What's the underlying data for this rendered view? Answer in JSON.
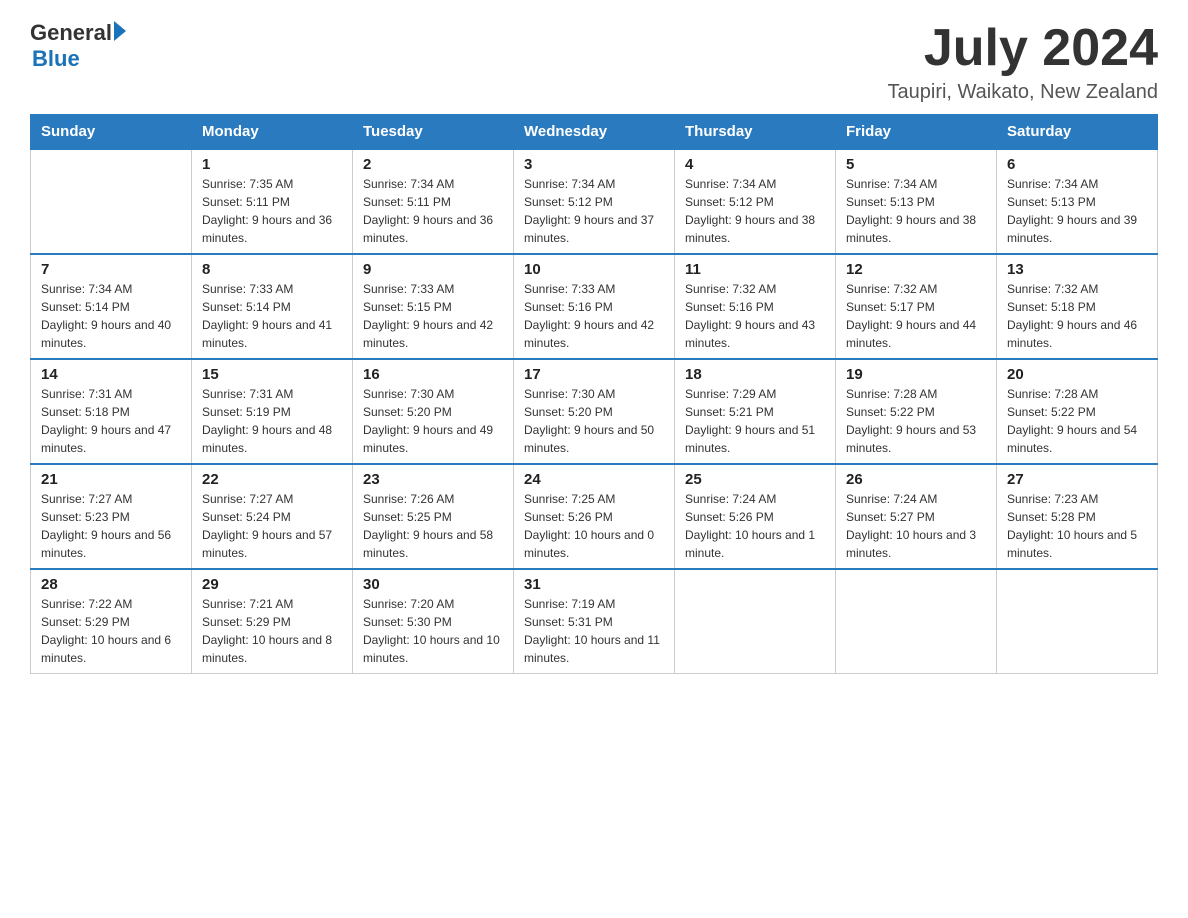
{
  "header": {
    "logo_general": "General",
    "logo_blue": "Blue",
    "month_title": "July 2024",
    "location": "Taupiri, Waikato, New Zealand"
  },
  "weekdays": [
    "Sunday",
    "Monday",
    "Tuesday",
    "Wednesday",
    "Thursday",
    "Friday",
    "Saturday"
  ],
  "weeks": [
    [
      {
        "day": "",
        "sunrise": "",
        "sunset": "",
        "daylight": ""
      },
      {
        "day": "1",
        "sunrise": "Sunrise: 7:35 AM",
        "sunset": "Sunset: 5:11 PM",
        "daylight": "Daylight: 9 hours and 36 minutes."
      },
      {
        "day": "2",
        "sunrise": "Sunrise: 7:34 AM",
        "sunset": "Sunset: 5:11 PM",
        "daylight": "Daylight: 9 hours and 36 minutes."
      },
      {
        "day": "3",
        "sunrise": "Sunrise: 7:34 AM",
        "sunset": "Sunset: 5:12 PM",
        "daylight": "Daylight: 9 hours and 37 minutes."
      },
      {
        "day": "4",
        "sunrise": "Sunrise: 7:34 AM",
        "sunset": "Sunset: 5:12 PM",
        "daylight": "Daylight: 9 hours and 38 minutes."
      },
      {
        "day": "5",
        "sunrise": "Sunrise: 7:34 AM",
        "sunset": "Sunset: 5:13 PM",
        "daylight": "Daylight: 9 hours and 38 minutes."
      },
      {
        "day": "6",
        "sunrise": "Sunrise: 7:34 AM",
        "sunset": "Sunset: 5:13 PM",
        "daylight": "Daylight: 9 hours and 39 minutes."
      }
    ],
    [
      {
        "day": "7",
        "sunrise": "Sunrise: 7:34 AM",
        "sunset": "Sunset: 5:14 PM",
        "daylight": "Daylight: 9 hours and 40 minutes."
      },
      {
        "day": "8",
        "sunrise": "Sunrise: 7:33 AM",
        "sunset": "Sunset: 5:14 PM",
        "daylight": "Daylight: 9 hours and 41 minutes."
      },
      {
        "day": "9",
        "sunrise": "Sunrise: 7:33 AM",
        "sunset": "Sunset: 5:15 PM",
        "daylight": "Daylight: 9 hours and 42 minutes."
      },
      {
        "day": "10",
        "sunrise": "Sunrise: 7:33 AM",
        "sunset": "Sunset: 5:16 PM",
        "daylight": "Daylight: 9 hours and 42 minutes."
      },
      {
        "day": "11",
        "sunrise": "Sunrise: 7:32 AM",
        "sunset": "Sunset: 5:16 PM",
        "daylight": "Daylight: 9 hours and 43 minutes."
      },
      {
        "day": "12",
        "sunrise": "Sunrise: 7:32 AM",
        "sunset": "Sunset: 5:17 PM",
        "daylight": "Daylight: 9 hours and 44 minutes."
      },
      {
        "day": "13",
        "sunrise": "Sunrise: 7:32 AM",
        "sunset": "Sunset: 5:18 PM",
        "daylight": "Daylight: 9 hours and 46 minutes."
      }
    ],
    [
      {
        "day": "14",
        "sunrise": "Sunrise: 7:31 AM",
        "sunset": "Sunset: 5:18 PM",
        "daylight": "Daylight: 9 hours and 47 minutes."
      },
      {
        "day": "15",
        "sunrise": "Sunrise: 7:31 AM",
        "sunset": "Sunset: 5:19 PM",
        "daylight": "Daylight: 9 hours and 48 minutes."
      },
      {
        "day": "16",
        "sunrise": "Sunrise: 7:30 AM",
        "sunset": "Sunset: 5:20 PM",
        "daylight": "Daylight: 9 hours and 49 minutes."
      },
      {
        "day": "17",
        "sunrise": "Sunrise: 7:30 AM",
        "sunset": "Sunset: 5:20 PM",
        "daylight": "Daylight: 9 hours and 50 minutes."
      },
      {
        "day": "18",
        "sunrise": "Sunrise: 7:29 AM",
        "sunset": "Sunset: 5:21 PM",
        "daylight": "Daylight: 9 hours and 51 minutes."
      },
      {
        "day": "19",
        "sunrise": "Sunrise: 7:28 AM",
        "sunset": "Sunset: 5:22 PM",
        "daylight": "Daylight: 9 hours and 53 minutes."
      },
      {
        "day": "20",
        "sunrise": "Sunrise: 7:28 AM",
        "sunset": "Sunset: 5:22 PM",
        "daylight": "Daylight: 9 hours and 54 minutes."
      }
    ],
    [
      {
        "day": "21",
        "sunrise": "Sunrise: 7:27 AM",
        "sunset": "Sunset: 5:23 PM",
        "daylight": "Daylight: 9 hours and 56 minutes."
      },
      {
        "day": "22",
        "sunrise": "Sunrise: 7:27 AM",
        "sunset": "Sunset: 5:24 PM",
        "daylight": "Daylight: 9 hours and 57 minutes."
      },
      {
        "day": "23",
        "sunrise": "Sunrise: 7:26 AM",
        "sunset": "Sunset: 5:25 PM",
        "daylight": "Daylight: 9 hours and 58 minutes."
      },
      {
        "day": "24",
        "sunrise": "Sunrise: 7:25 AM",
        "sunset": "Sunset: 5:26 PM",
        "daylight": "Daylight: 10 hours and 0 minutes."
      },
      {
        "day": "25",
        "sunrise": "Sunrise: 7:24 AM",
        "sunset": "Sunset: 5:26 PM",
        "daylight": "Daylight: 10 hours and 1 minute."
      },
      {
        "day": "26",
        "sunrise": "Sunrise: 7:24 AM",
        "sunset": "Sunset: 5:27 PM",
        "daylight": "Daylight: 10 hours and 3 minutes."
      },
      {
        "day": "27",
        "sunrise": "Sunrise: 7:23 AM",
        "sunset": "Sunset: 5:28 PM",
        "daylight": "Daylight: 10 hours and 5 minutes."
      }
    ],
    [
      {
        "day": "28",
        "sunrise": "Sunrise: 7:22 AM",
        "sunset": "Sunset: 5:29 PM",
        "daylight": "Daylight: 10 hours and 6 minutes."
      },
      {
        "day": "29",
        "sunrise": "Sunrise: 7:21 AM",
        "sunset": "Sunset: 5:29 PM",
        "daylight": "Daylight: 10 hours and 8 minutes."
      },
      {
        "day": "30",
        "sunrise": "Sunrise: 7:20 AM",
        "sunset": "Sunset: 5:30 PM",
        "daylight": "Daylight: 10 hours and 10 minutes."
      },
      {
        "day": "31",
        "sunrise": "Sunrise: 7:19 AM",
        "sunset": "Sunset: 5:31 PM",
        "daylight": "Daylight: 10 hours and 11 minutes."
      },
      {
        "day": "",
        "sunrise": "",
        "sunset": "",
        "daylight": ""
      },
      {
        "day": "",
        "sunrise": "",
        "sunset": "",
        "daylight": ""
      },
      {
        "day": "",
        "sunrise": "",
        "sunset": "",
        "daylight": ""
      }
    ]
  ]
}
